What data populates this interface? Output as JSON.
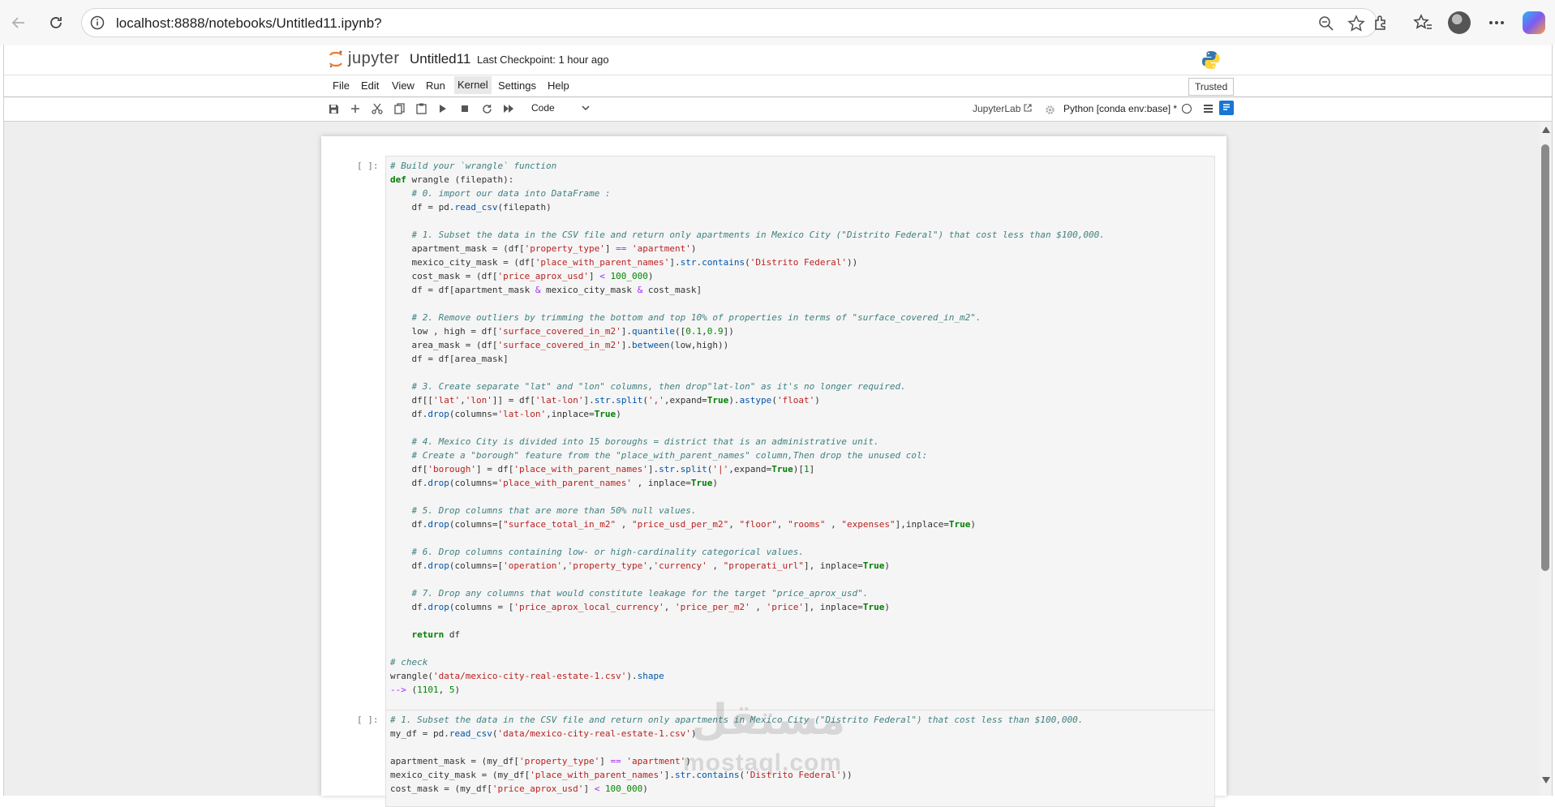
{
  "browser": {
    "url": "localhost:8888/notebooks/Untitled11.ipynb?"
  },
  "jupyter": {
    "logo_text": "jupyter",
    "notebook_title": "Untitled11",
    "checkpoint": "Last Checkpoint: 1 hour ago",
    "menu": [
      "File",
      "Edit",
      "View",
      "Run",
      "Kernel",
      "Settings",
      "Help"
    ],
    "active_menu": "Kernel",
    "trusted": "Trusted",
    "cell_type": "Code",
    "jupyterlab_link": "JupyterLab",
    "kernel": "Python [conda env:base] *"
  },
  "cells": [
    {
      "prompt": "[ ]:",
      "lines": [
        "# Build your `wrangle` function",
        "def wrangle (filepath):",
        "    # 0. import our data into DataFrame :",
        "    df = pd.read_csv(filepath)",
        "",
        "    # 1. Subset the data in the CSV file and return only apartments in Mexico City (\"Distrito Federal\") that cost less than $100,000.",
        "    apartment_mask = (df['property_type'] == 'apartment')",
        "    mexico_city_mask = (df['place_with_parent_names'].str.contains('Distrito Federal'))",
        "    cost_mask = (df['price_aprox_usd'] < 100_000)",
        "    df = df[apartment_mask & mexico_city_mask & cost_mask]",
        "",
        "    # 2. Remove outliers by trimming the bottom and top 10% of properties in terms of \"surface_covered_in_m2\".",
        "    low , high = df['surface_covered_in_m2'].quantile([0.1,0.9])",
        "    area_mask = (df['surface_covered_in_m2'].between(low,high))",
        "    df = df[area_mask]",
        "",
        "    # 3. Create separate \"lat\" and \"lon\" columns, then drop\"lat-lon\" as it's no longer required.",
        "    df[['lat','lon']] = df['lat-lon'].str.split(',',expand=True).astype('float')",
        "    df.drop(columns='lat-lon',inplace=True)",
        "",
        "    # 4. Mexico City is divided into 15 boroughs = district that is an administrative unit.",
        "    # Create a \"borough\" feature from the \"place_with_parent_names\" column,Then drop the unused col:",
        "    df['borough'] = df['place_with_parent_names'].str.split('|',expand=True)[1]",
        "    df.drop(columns='place_with_parent_names' , inplace=True)",
        "",
        "    # 5. Drop columns that are more than 50% null values.",
        "    df.drop(columns=[\"surface_total_in_m2\" , \"price_usd_per_m2\", \"floor\", \"rooms\" , \"expenses\"],inplace=True)",
        "",
        "    # 6. Drop columns containing low- or high-cardinality categorical values.",
        "    df.drop(columns=['operation','property_type','currency' , \"properati_url\"], inplace=True)",
        "",
        "    # 7. Drop any columns that would constitute leakage for the target \"price_aprox_usd\".",
        "    df.drop(columns = ['price_aprox_local_currency', 'price_per_m2' , 'price'], inplace=True)",
        "",
        "    return df",
        "",
        "# check",
        "wrangle('data/mexico-city-real-estate-1.csv').shape",
        "--> (1101, 5)"
      ]
    },
    {
      "prompt": "[ ]:",
      "lines": [
        "# 1. Subset the data in the CSV file and return only apartments in Mexico City (\"Distrito Federal\") that cost less than $100,000.",
        "my_df = pd.read_csv('data/mexico-city-real-estate-1.csv')",
        "",
        "apartment_mask = (my_df['property_type'] == 'apartment')",
        "mexico_city_mask = (my_df['place_with_parent_names'].str.contains('Distrito Federal'))",
        "cost_mask = (my_df['price_aprox_usd'] < 100_000)"
      ]
    }
  ],
  "watermark": {
    "latin": "mostaql.com",
    "arabic": "مستقل"
  }
}
